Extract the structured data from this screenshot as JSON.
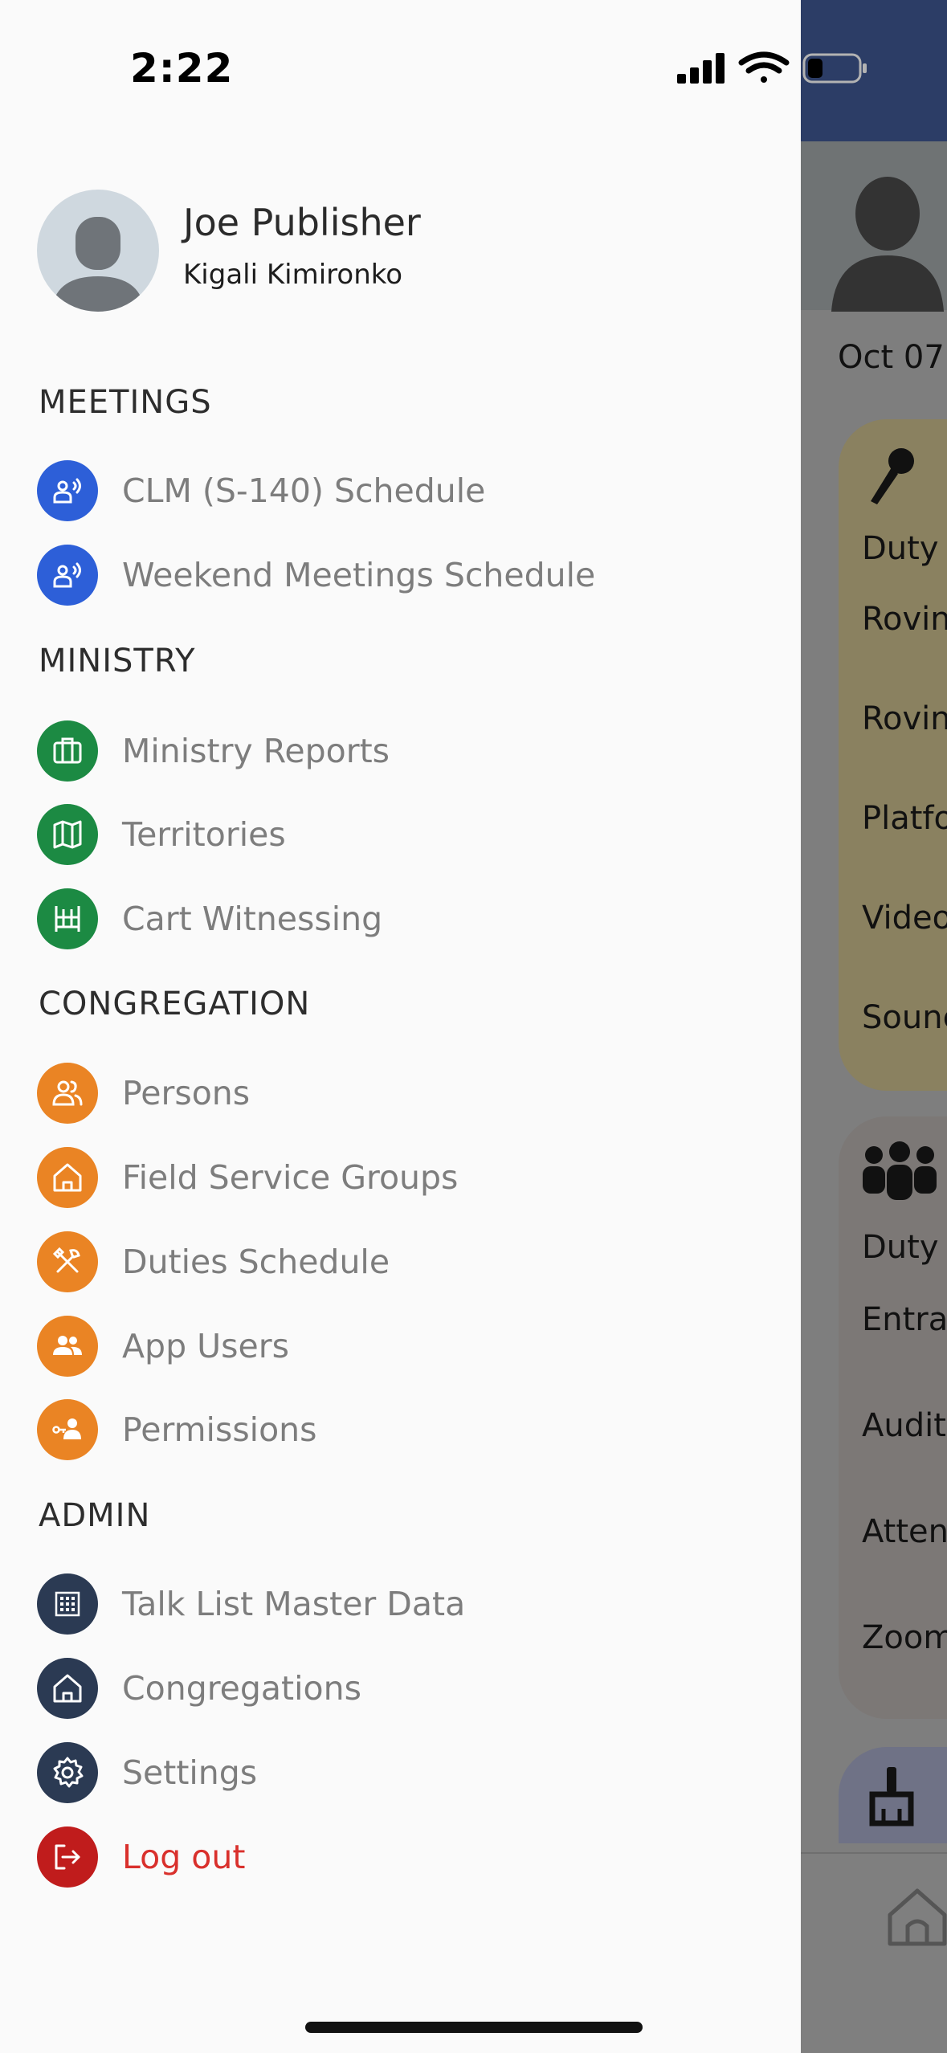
{
  "status_bar": {
    "time": "2:22"
  },
  "user": {
    "name": "Joe Publisher",
    "congregation": "Kigali Kimironko"
  },
  "sections": [
    {
      "title": "MEETINGS",
      "items": [
        {
          "label": "CLM (S-140) Schedule",
          "icon": "presenter-broadcast-icon",
          "color": "#2d5fd8"
        },
        {
          "label": "Weekend Meetings Schedule",
          "icon": "presenter-broadcast-icon",
          "color": "#2d5fd8"
        }
      ]
    },
    {
      "title": "MINISTRY",
      "items": [
        {
          "label": "Ministry Reports",
          "icon": "briefcase-icon",
          "color": "#1c8a43"
        },
        {
          "label": "Territories",
          "icon": "map-icon",
          "color": "#1c8a43"
        },
        {
          "label": "Cart Witnessing",
          "icon": "cart-stand-icon",
          "color": "#1c8a43"
        }
      ]
    },
    {
      "title": "CONGREGATION",
      "items": [
        {
          "label": "Persons",
          "icon": "people-icon",
          "color": "#ea8424"
        },
        {
          "label": "Field Service Groups",
          "icon": "home-icon",
          "color": "#ea8424"
        },
        {
          "label": "Duties Schedule",
          "icon": "tools-icon",
          "color": "#ea8424"
        },
        {
          "label": "App Users",
          "icon": "users-icon",
          "color": "#ea8424"
        },
        {
          "label": "Permissions",
          "icon": "user-key-icon",
          "color": "#ea8424"
        }
      ]
    },
    {
      "title": "ADMIN",
      "items": [
        {
          "label": "Talk List Master Data",
          "icon": "grid-icon",
          "color": "#2b3a53"
        },
        {
          "label": "Congregations",
          "icon": "home-icon",
          "color": "#2b3a53"
        },
        {
          "label": "Settings",
          "icon": "gear-icon",
          "color": "#2b3a53"
        },
        {
          "label": "Log out",
          "icon": "logout-icon",
          "color": "#c01c1c"
        }
      ]
    }
  ],
  "background": {
    "date": "Oct 07",
    "card1_rows": [
      "Duty",
      "Rovin",
      "Rovin",
      "Platfo",
      "Video",
      "Sounc"
    ],
    "card2_rows": [
      "Duty",
      "Entra",
      "Audit",
      "Atten",
      "Zoom"
    ]
  }
}
